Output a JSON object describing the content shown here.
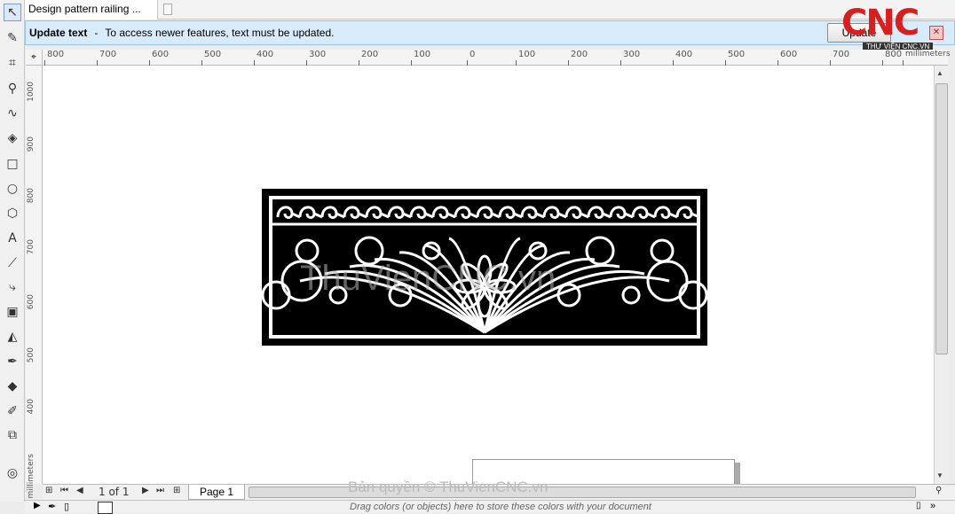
{
  "document": {
    "tab_title": "Design pattern railing ..."
  },
  "notification": {
    "title": "Update text",
    "separator": "-",
    "message": "To access newer features, text must be updated.",
    "button_label": "Update"
  },
  "logo": {
    "text": "CNC",
    "subtext": "THƯ VIỆN CNC.VN"
  },
  "rulers": {
    "unit": "millimeters",
    "horizontal_ticks": [
      "800",
      "700",
      "600",
      "500",
      "400",
      "300",
      "200",
      "100",
      "0",
      "100",
      "200",
      "300",
      "400",
      "500",
      "600",
      "700",
      "800"
    ],
    "vertical_ticks": [
      "1000",
      "900",
      "800",
      "700",
      "600",
      "500",
      "400"
    ]
  },
  "canvas": {
    "watermark": "ThuVienCNC.vn"
  },
  "page_nav": {
    "counter": "1 of 1",
    "page_tab": "Page 1"
  },
  "status": {
    "drag_hint": "Drag colors (or objects) here to store these colors with your document",
    "copyright": "Bản quyền © ThuVienCNC.vn"
  },
  "colors": {
    "accent_blue": "#d8ebfa",
    "logo_red": "#d62020"
  },
  "icons": [
    "pick-tool-icon",
    "shape-tool-icon",
    "crop-tool-icon",
    "zoom-tool-icon",
    "freehand-tool-icon",
    "smart-fill-icon",
    "rectangle-tool-icon",
    "ellipse-tool-icon",
    "polygon-tool-icon",
    "text-tool-icon",
    "dimension-tool-icon",
    "connector-tool-icon",
    "drop-shadow-icon",
    "transparency-icon",
    "eyedropper-icon",
    "interactive-fill-icon",
    "smart-fill-2-icon",
    "outline-pen-icon",
    "color-eyedropper-icon"
  ]
}
